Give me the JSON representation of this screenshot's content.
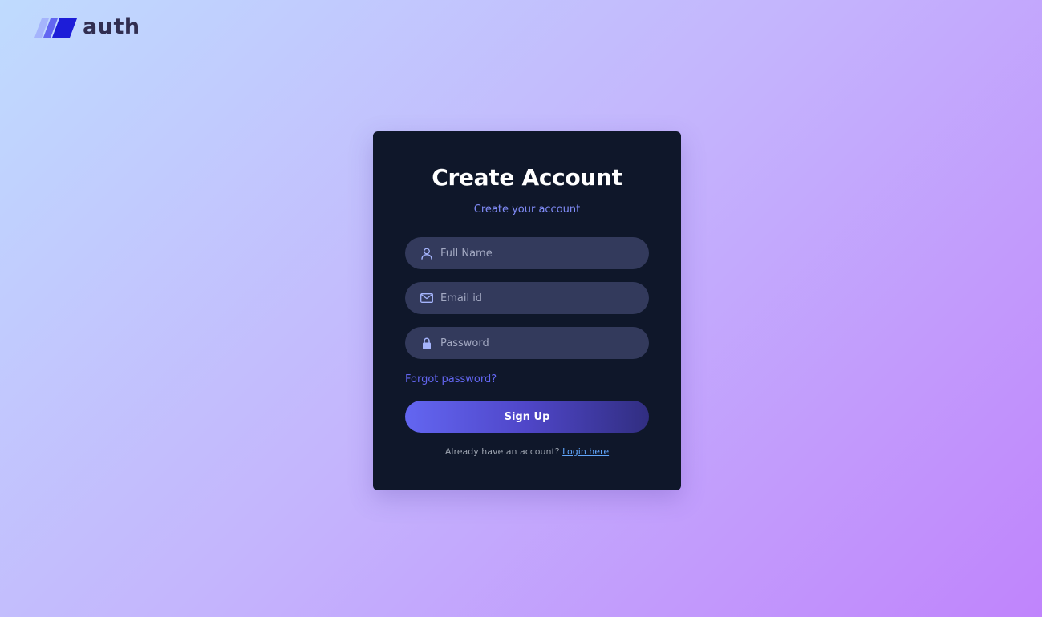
{
  "brand": {
    "name": "auth",
    "icon": "slanted-stripes-logo-icon",
    "colors": [
      "#a5b4fc",
      "#6366f1",
      "#1d1dd8"
    ]
  },
  "card": {
    "title": "Create Account",
    "subtitle": "Create your account",
    "fields": {
      "full_name": {
        "placeholder": "Full Name",
        "value": "",
        "icon": "person-icon"
      },
      "email": {
        "placeholder": "Email id",
        "value": "",
        "icon": "mail-icon"
      },
      "password": {
        "placeholder": "Password",
        "value": "",
        "icon": "lock-icon"
      }
    },
    "forgot_label": "Forgot password?",
    "signup_label": "Sign Up",
    "login_prompt": "Already have an account?",
    "login_link": "Login here"
  },
  "colors": {
    "accent": "#6366f1",
    "card_bg": "#0f172a",
    "field_bg": "#333a5c",
    "link": "#60a5fa"
  }
}
